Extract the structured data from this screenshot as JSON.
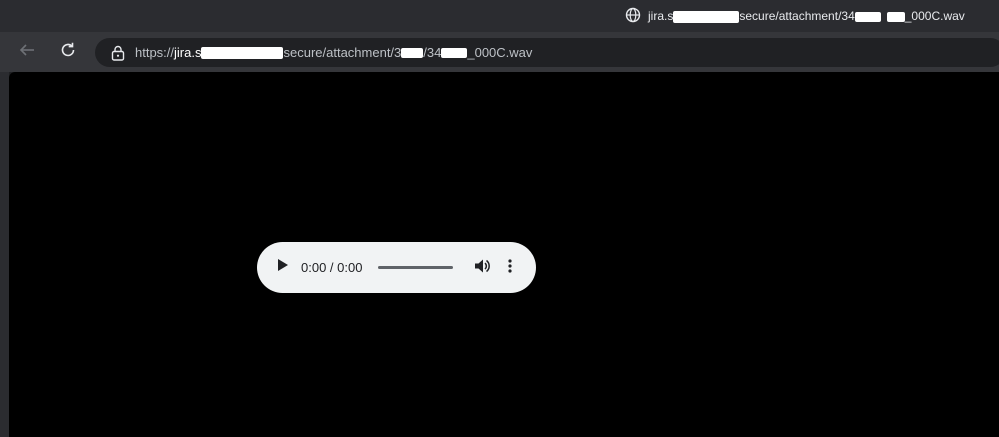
{
  "tab": {
    "title_start": "jira.s",
    "title_mid": "secure/attachment/34",
    "title_end": "_000C.wav",
    "icon": "globe-icon"
  },
  "toolbar": {
    "back_icon": "arrow-left-icon",
    "reload_icon": "reload-icon"
  },
  "omnibox": {
    "scheme": "https://",
    "host_start": "jira.s",
    "path_mid": "secure/attachment/3",
    "path_mid2": "/34",
    "path_end": "_000C.wav",
    "icon": "site-info-icon"
  },
  "player": {
    "time": "0:00 / 0:00",
    "progress": 0,
    "play_icon": "play-icon",
    "volume_icon": "volume-icon",
    "more_icon": "more-vertical-icon"
  },
  "colors": {
    "page_background": "#000000",
    "player_background": "#f1f3f4"
  }
}
